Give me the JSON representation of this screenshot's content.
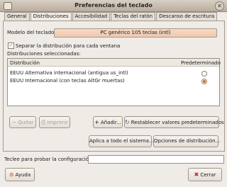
{
  "window": {
    "title": "Preferencias del teclado"
  },
  "tabs": [
    {
      "label": "General"
    },
    {
      "label": "Distribuciones"
    },
    {
      "label": "Accesibilidad"
    },
    {
      "label": "Teclas del ratón"
    },
    {
      "label": "Descanso de escritura"
    }
  ],
  "layouts": {
    "model_label": "Modelo del teclado:",
    "model_value": "PC genérico 105 teclas (intl)",
    "separate_label": "Separar la distribución para cada ventana",
    "separate_checked": true,
    "selected_label": "Distribuciones seleccionadas:",
    "columns": {
      "layout": "Distribución",
      "default": "Predeterminado"
    },
    "rows": [
      {
        "name": "EEUU Alternativa internacional (antigua us_intl)",
        "default": false
      },
      {
        "name": "EEUU Internacional (con teclas AltGr muertas)",
        "default": true
      }
    ],
    "buttons": {
      "remove": "Quitar",
      "print": "Imprimir",
      "add": "Añadir...",
      "reset": "Restablecer valores predeterminados",
      "apply_system": "Aplica a todo el sistema...",
      "options": "Opciones de distribución..."
    }
  },
  "test": {
    "label": "Teclee para probar la configuración:",
    "value": ""
  },
  "footer": {
    "help": "Ayuda",
    "close": "Cerrar"
  },
  "colors": {
    "accent": "#e25d12",
    "model_button": "#f2cdb6"
  }
}
